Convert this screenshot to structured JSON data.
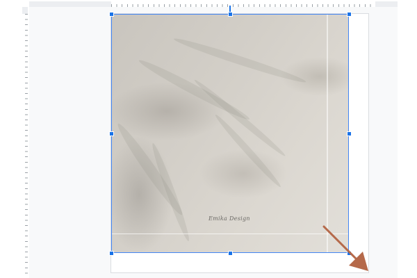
{
  "editor": {
    "ruler_top": "horizontal-ruler",
    "ruler_left": "vertical-ruler"
  },
  "image": {
    "signature_text": "Emika Design"
  },
  "annotation": {
    "arrow_color": "#b5694a"
  },
  "colors": {
    "selection": "#4285f4",
    "handle": "#1a73e8",
    "canvas_bg": "#f8f9fa"
  }
}
